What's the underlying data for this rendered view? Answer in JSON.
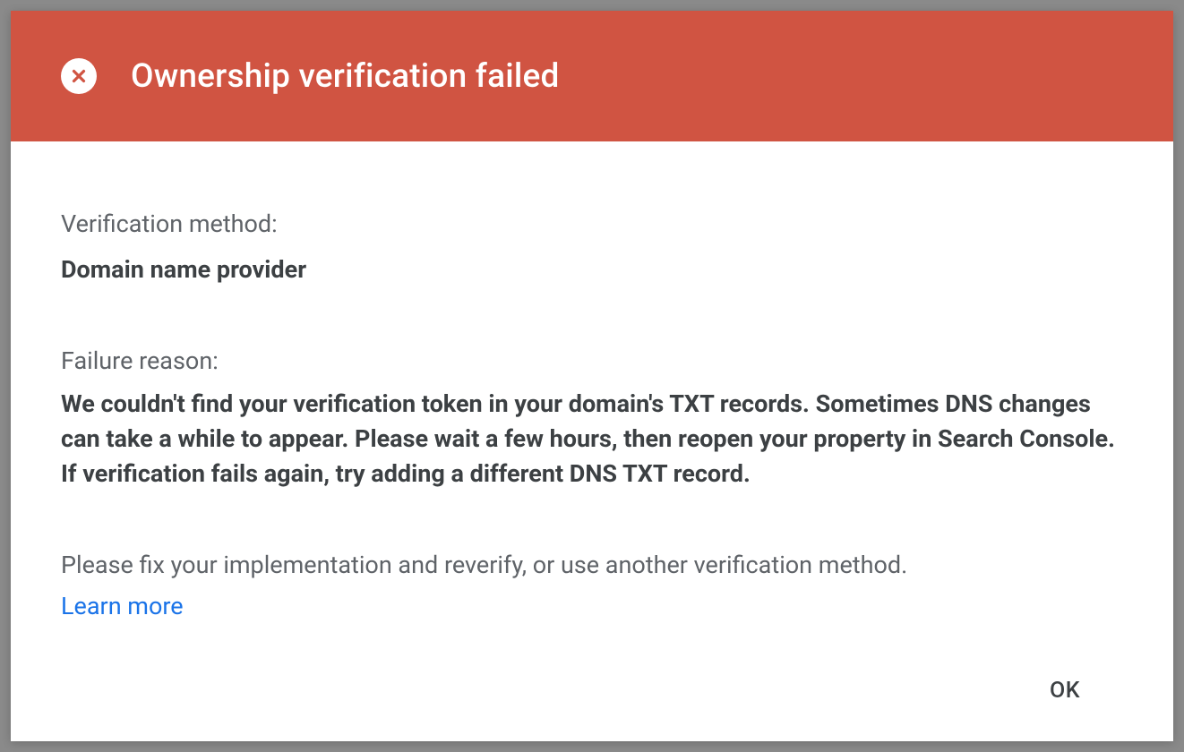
{
  "dialog": {
    "title": "Ownership verification failed",
    "method_label": "Verification method:",
    "method_value": "Domain name provider",
    "reason_label": "Failure reason:",
    "reason_value": "We couldn't find your verification token in your domain's TXT records. Sometimes DNS changes can take a while to appear. Please wait a few hours, then reopen your property in Search Console. If verification fails again, try adding a different DNS TXT record.",
    "hint_text": "Please fix your implementation and reverify, or use another verification method.",
    "learn_more_label": "Learn more",
    "ok_label": "OK"
  },
  "colors": {
    "header_bg": "#d05442",
    "link": "#1a73e8",
    "text_primary": "#3c4043",
    "text_secondary": "#5f6368"
  }
}
